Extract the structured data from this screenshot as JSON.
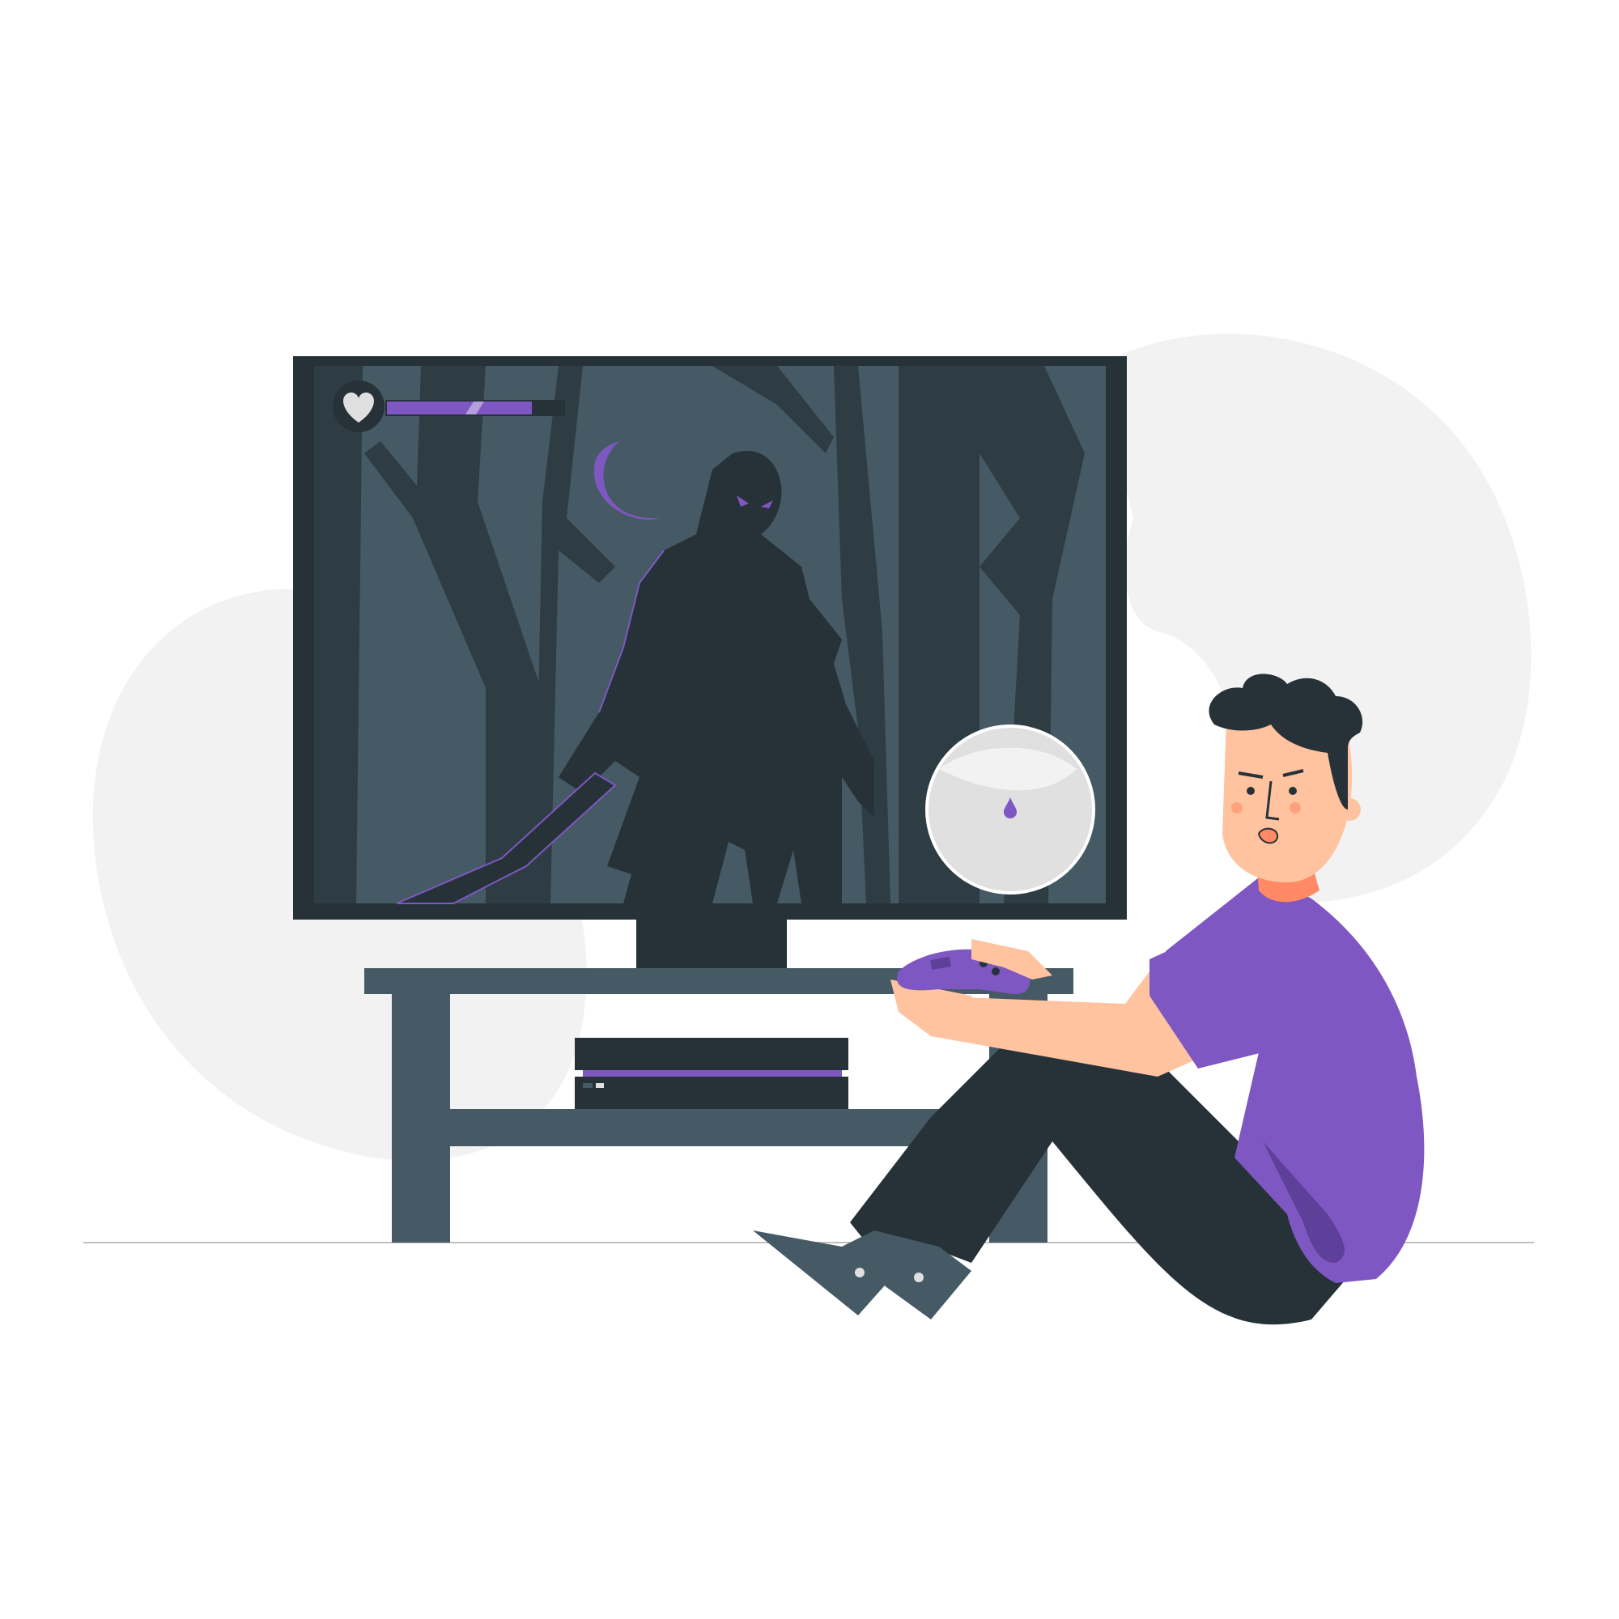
{
  "scene": {
    "description_free": true,
    "colors": {
      "background": "#ffffff",
      "blob": "#f2f2f2",
      "screen_dark": "#263238",
      "screen_mid": "#455a64",
      "tree_dark": "#2e3c44",
      "accent_purple": "#7e57c2",
      "accent_purple_dark": "#5e3f9a",
      "skin": "#ffc3a0",
      "skin_shadow": "#ff8a65",
      "furniture": "#455a64",
      "floor_line": "#bfbfbf",
      "snow_globe": "#e0e0e0",
      "shoe_sole": "#e0e0e0"
    },
    "hud": {
      "icon": "heart-icon",
      "health_fraction": 0.82
    },
    "moon": {
      "icon": "crescent-moon-icon"
    },
    "controller": {
      "icon": "gamepad-icon"
    }
  }
}
